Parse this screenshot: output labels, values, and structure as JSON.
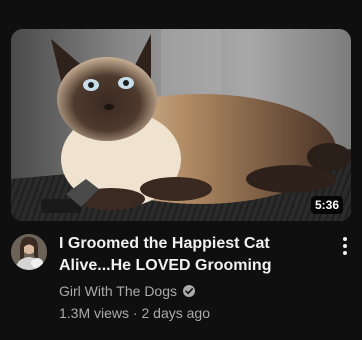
{
  "video": {
    "title": "I Groomed the Happiest Cat Alive...He LOVED Grooming",
    "duration": "5:36",
    "channel": "Girl With The Dogs",
    "views": "1.3M views",
    "separator": "·",
    "uploaded": "2 days ago"
  },
  "icons": {
    "verified": "verified-check-icon",
    "more": "more-vert-icon"
  },
  "colors": {
    "background": "#0f0f0f",
    "title": "#f1f1f1",
    "secondary_text": "#aaaaaa"
  }
}
